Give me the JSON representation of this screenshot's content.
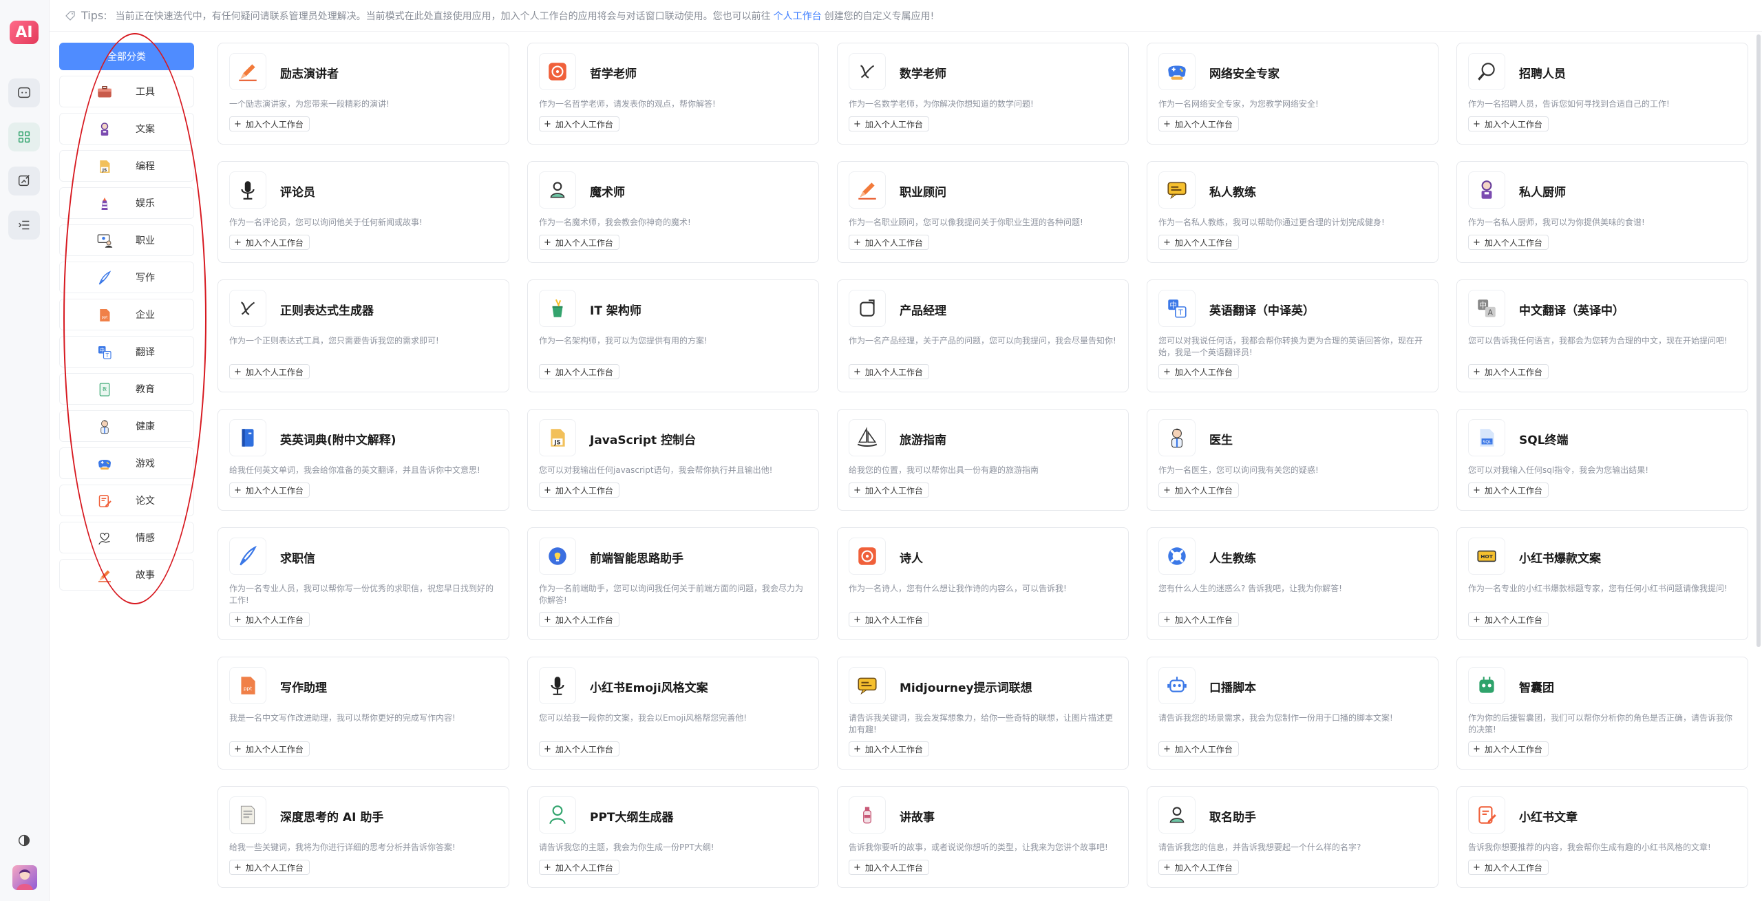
{
  "app": {
    "logo": "AI"
  },
  "tips": {
    "label": "Tips:",
    "text": "当前正在快速迭代中，有任何疑问请联系管理员处理解决。当前模式在此处直接使用应用，加入个人工作台的应用将会与对话窗口联动使用。您也可以前往",
    "link": "个人工作台",
    "suffix": "创建您的自定义专属应用!"
  },
  "categories": {
    "all_label": "全部分类",
    "items": [
      {
        "label": "工具",
        "icon": "toolbox-icon"
      },
      {
        "label": "文案",
        "icon": "robot-icon"
      },
      {
        "label": "编程",
        "icon": "js-file-icon"
      },
      {
        "label": "娱乐",
        "icon": "lighthouse-icon"
      },
      {
        "label": "职业",
        "icon": "teacher-icon"
      },
      {
        "label": "写作",
        "icon": "quill-icon"
      },
      {
        "label": "企业",
        "icon": "ppt-file-icon"
      },
      {
        "label": "翻译",
        "icon": "translate-icon"
      },
      {
        "label": "教育",
        "icon": "book-icon"
      },
      {
        "label": "健康",
        "icon": "doctor-icon"
      },
      {
        "label": "游戏",
        "icon": "gamepad-icon"
      },
      {
        "label": "论文",
        "icon": "document-edit-icon"
      },
      {
        "label": "情感",
        "icon": "heart-hand-icon"
      },
      {
        "label": "故事",
        "icon": "pen-icon"
      }
    ]
  },
  "add_label": "加入个人工作台",
  "cards": [
    {
      "title": "励志演讲者",
      "desc": "一个励志演讲家，为您带来一段精彩的演讲!",
      "icon": "pen-icon"
    },
    {
      "title": "哲学老师",
      "desc": "作为一名哲学老师，请发表你的观点，帮你解答!",
      "icon": "art-icon"
    },
    {
      "title": "数学老师",
      "desc": "作为一名数学老师，为你解决你想知道的数学问题!",
      "icon": "math-icon"
    },
    {
      "title": "网络安全专家",
      "desc": "作为一名网络安全专家，为您教学网络安全!",
      "icon": "gamepad-icon"
    },
    {
      "title": "招聘人员",
      "desc": "作为一名招聘人员，告诉您如何寻找到合适自己的工作!",
      "icon": "magnifier-icon"
    },
    {
      "title": "评论员",
      "desc": "作为一名评论员，您可以询问他关于任何新闻或故事!",
      "icon": "microphone-icon"
    },
    {
      "title": "魔术师",
      "desc": "作为一名魔术师，我会教会你神奇的魔术!",
      "icon": "user-pin-icon"
    },
    {
      "title": "职业顾问",
      "desc": "作为一名职业顾问，您可以像我提问关于你职业生涯的各种问题!",
      "icon": "pen-icon"
    },
    {
      "title": "私人教练",
      "desc": "作为一名私人教练，我可以帮助你通过更合理的计划完成健身!",
      "icon": "chat-icon"
    },
    {
      "title": "私人厨师",
      "desc": "作为一名私人厨师，我可以为你提供美味的食谱!",
      "icon": "robot-icon"
    },
    {
      "title": "正则表达式生成器",
      "desc": "作为一个正则表达式工具，您只需要告诉我您的需求即可!",
      "icon": "math-icon"
    },
    {
      "title": "IT 架构师",
      "desc": "作为一名架构师，我可以为您提供有用的方案!",
      "icon": "cup-icon"
    },
    {
      "title": "产品经理",
      "desc": "作为一名产品经理，关于产品的问题，您可以向我提问，我会尽量告知你!",
      "icon": "share-icon"
    },
    {
      "title": "英语翻译（中译英）",
      "desc": "您可以对我说任何话，我都会帮你转换为更为合理的英语回答你，现在开始，我是一个英语翻译员!",
      "icon": "translate-icon"
    },
    {
      "title": "中文翻译（英译中）",
      "desc": "您可以告诉我任何语言，我都会为您转为合理的中文，现在开始提问吧!",
      "icon": "translate-gray-icon"
    },
    {
      "title": "英英词典(附中文解释)",
      "desc": "给我任何英文单词，我会给你准备的英文翻译，并且告诉你中文意思!",
      "icon": "dictionary-icon"
    },
    {
      "title": "JavaScript 控制台",
      "desc": "您可以对我输出任何javascript语句，我会帮你执行并且输出他!",
      "icon": "js-file-icon"
    },
    {
      "title": "旅游指南",
      "desc": "给我您的位置，我可以帮你出具一份有趣的旅游指南",
      "icon": "sailboat-icon"
    },
    {
      "title": "医生",
      "desc": "作为一名医生，您可以询问我有关您的疑惑!",
      "icon": "doctor-icon"
    },
    {
      "title": "SQL终端",
      "desc": "您可以对我输入任何sql指令，我会为您输出结果!",
      "icon": "sql-file-icon"
    },
    {
      "title": "求职信",
      "desc": "作为一名专业人员，我可以帮你写一份优秀的求职信，祝您早日找到好的工作!",
      "icon": "quill-icon"
    },
    {
      "title": "前端智能思路助手",
      "desc": "作为一名前端助手，您可以询问我任何关于前端方面的问题，我会尽力为你解答!",
      "icon": "bulb-icon"
    },
    {
      "title": "诗人",
      "desc": "作为一名诗人，您有什么想让我作诗的内容么，可以告诉我!",
      "icon": "art-icon"
    },
    {
      "title": "人生教练",
      "desc": "您有什么人生的迷惑么? 告诉我吧，让我为你解答!",
      "icon": "lifebuoy-icon"
    },
    {
      "title": "小红书爆款文案",
      "desc": "作为一名专业的小红书爆款标题专家，您有任何小红书问题请像我提问!",
      "icon": "tag-icon"
    },
    {
      "title": "写作助理",
      "desc": "我是一名中文写作改进助理，我可以帮你更好的完成写作内容!",
      "icon": "ppt-file-icon"
    },
    {
      "title": "小红书Emoji风格文案",
      "desc": "您可以给我一段你的文案，我会以Emoji风格帮您完善他!",
      "icon": "microphone-icon"
    },
    {
      "title": "Midjourney提示词联想",
      "desc": "请告诉我关键词，我会发挥想象力，给你一些奇特的联想，让图片描述更加有趣!",
      "icon": "chat-icon"
    },
    {
      "title": "口播脚本",
      "desc": "请告诉我您的场景需求，我会为您制作一份用于口播的脚本文案!",
      "icon": "bot-blue-icon"
    },
    {
      "title": "智囊团",
      "desc": "作为你的后援智囊团，我们可以帮你分析你的角色是否正确，请告诉我你的决策!",
      "icon": "bot-green-icon"
    },
    {
      "title": "深度思考的 AI 助手",
      "desc": "给我一些关键词，我将为你进行详细的思考分析并告诉你答案!",
      "icon": "document-icon"
    },
    {
      "title": "PPT大纲生成器",
      "desc": "请告诉我您的主题，我会为你生成一份PPT大纲!",
      "icon": "person-icon"
    },
    {
      "title": "讲故事",
      "desc": "告诉我你要听的故事，或者说说你想听的类型，让我来为您讲个故事吧!",
      "icon": "bottle-icon"
    },
    {
      "title": "取名助手",
      "desc": "请告诉我您的信息，并告诉我想要起一个什么样的名字?",
      "icon": "user-pin-icon"
    },
    {
      "title": "小红书文章",
      "desc": "告诉我你想要推荐的内容，我会帮你生成有趣的小红书风格的文章!",
      "icon": "document-edit-icon"
    }
  ]
}
